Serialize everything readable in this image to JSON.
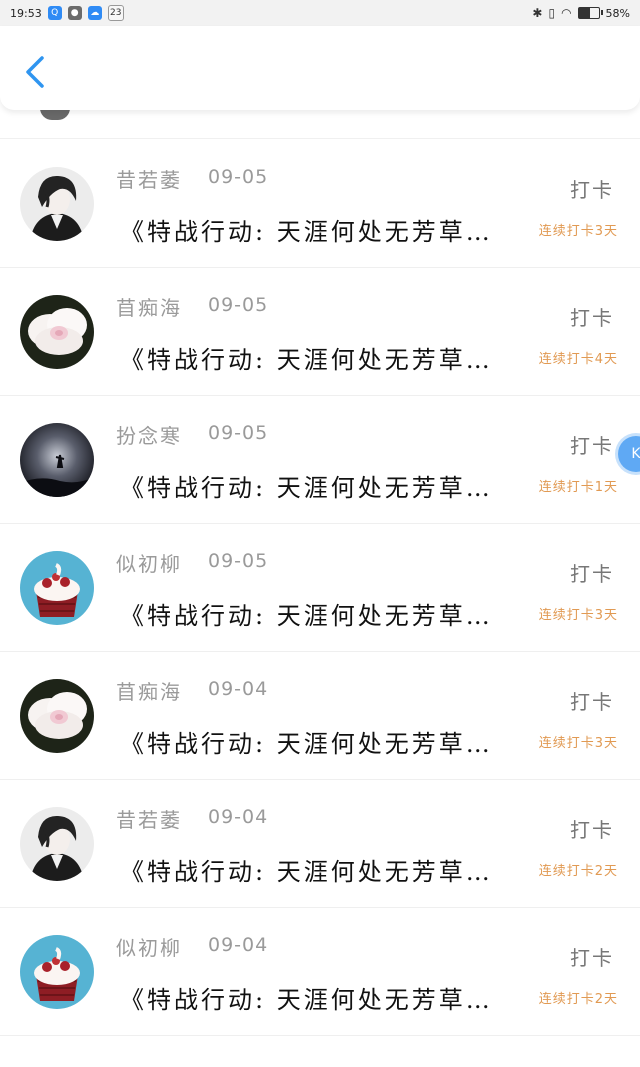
{
  "status_bar": {
    "time": "19:53",
    "notifications": [
      {
        "icon": "search-icon",
        "glyph": "Q"
      },
      {
        "icon": "wechat-icon",
        "glyph": "●"
      },
      {
        "icon": "cloud-icon",
        "glyph": "☁"
      },
      {
        "icon": "calendar-icon",
        "glyph": "23"
      }
    ],
    "battery_percent": "58%",
    "battery_level": 0.58
  },
  "header": {
    "back_icon": "chevron-left-icon",
    "accent_color": "#2f95f0"
  },
  "items": [
    {
      "username": "昔若萎",
      "date": "09-05",
      "action": "打卡",
      "title": "《特战行动: 天涯何处无芳草…",
      "streak": "连续打卡3天",
      "avatar": "anime-portrait"
    },
    {
      "username": "苜痴海",
      "date": "09-05",
      "action": "打卡",
      "title": "《特战行动: 天涯何处无芳草…",
      "streak": "连续打卡4天",
      "avatar": "white-flower"
    },
    {
      "username": "扮念寒",
      "date": "09-05",
      "action": "打卡",
      "title": "《特战行动: 天涯何处无芳草…",
      "streak": "连续打卡1天",
      "avatar": "night-silhouette"
    },
    {
      "username": "似初柳",
      "date": "09-05",
      "action": "打卡",
      "title": "《特战行动: 天涯何处无芳草…",
      "streak": "连续打卡3天",
      "avatar": "cupcake"
    },
    {
      "username": "苜痴海",
      "date": "09-04",
      "action": "打卡",
      "title": "《特战行动: 天涯何处无芳草…",
      "streak": "连续打卡3天",
      "avatar": "white-flower"
    },
    {
      "username": "昔若萎",
      "date": "09-04",
      "action": "打卡",
      "title": "《特战行动: 天涯何处无芳草…",
      "streak": "连续打卡2天",
      "avatar": "anime-portrait"
    },
    {
      "username": "似初柳",
      "date": "09-04",
      "action": "打卡",
      "title": "《特战行动: 天涯何处无芳草…",
      "streak": "连续打卡2天",
      "avatar": "cupcake"
    }
  ],
  "side_button": {
    "label": "K",
    "color": "#5fa9f4"
  },
  "colors": {
    "streak": "#e19a53",
    "muted_text": "#9a9a9a",
    "title_text": "#111111"
  }
}
